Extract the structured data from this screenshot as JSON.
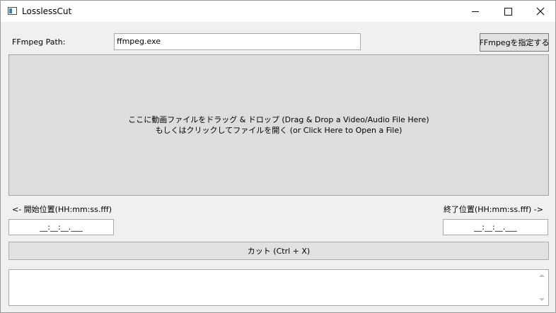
{
  "window": {
    "title": "LosslessCut",
    "icon": "app-window-icon"
  },
  "ffmpeg": {
    "label": "FFmpeg Path:",
    "value": "ffmpeg.exe",
    "button_label": "FFmpegを指定する"
  },
  "drop_zone": {
    "line1": "ここに動画ファイルをドラッグ & ドロップ (Drag & Drop a Video/Audio File Here)",
    "line2": "もしくはクリックしてファイルを開く (or Click Here to Open a File)"
  },
  "start": {
    "label": "<- 開始位置(HH:mm:ss.fff)",
    "value": "__:__:__.___"
  },
  "end": {
    "label": "終了位置(HH:mm:ss.fff) ->",
    "value": "__:__:__.___"
  },
  "cut_button": {
    "label": "カット (Ctrl + X)"
  },
  "log": {
    "value": ""
  }
}
